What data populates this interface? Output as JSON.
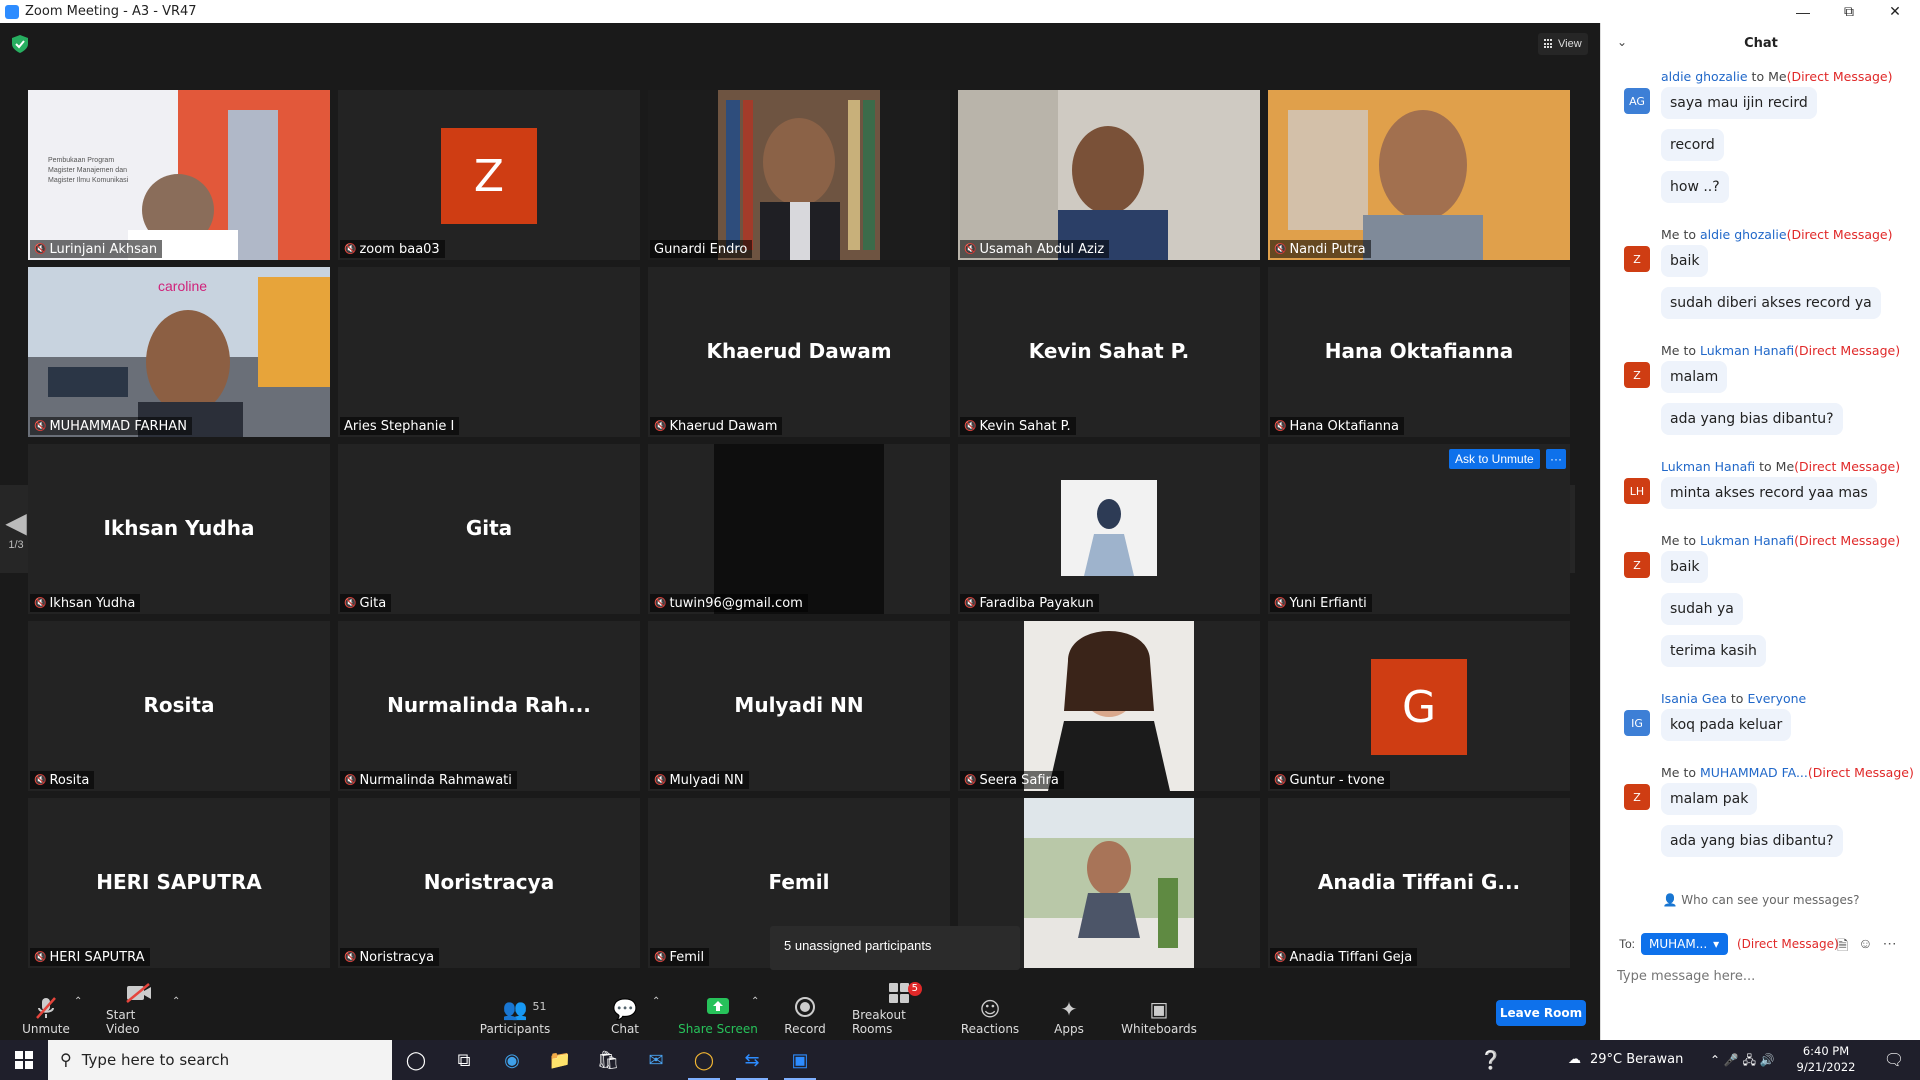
{
  "window": {
    "title": "Zoom Meeting - A3 - VR47"
  },
  "meeting": {
    "view_label": "View",
    "tiles": [
      {
        "name": "Lurinjani Akhsan",
        "big": "",
        "avatar": "",
        "kind": "video-slide"
      },
      {
        "name": "zoom baa03",
        "big": "",
        "avatar": "Z",
        "kind": "avatar"
      },
      {
        "name": "Gunardi Endro",
        "big": "",
        "avatar": "",
        "kind": "video-books"
      },
      {
        "name": "Usamah Abdul Aziz",
        "big": "",
        "avatar": "",
        "kind": "video-room"
      },
      {
        "name": "Nandi Putra",
        "big": "",
        "avatar": "",
        "kind": "video-warm"
      },
      {
        "name": "MUHAMMAD FARHAN",
        "big": "",
        "avatar": "",
        "kind": "video-outdoor"
      },
      {
        "name": "Aries Stephanie I",
        "big": "",
        "avatar": "",
        "kind": "blank"
      },
      {
        "name": "Khaerud Dawam",
        "big": "Khaerud Dawam",
        "avatar": "",
        "kind": "text"
      },
      {
        "name": "Kevin Sahat P.",
        "big": "Kevin Sahat P.",
        "avatar": "",
        "kind": "text"
      },
      {
        "name": "Hana Oktafianna",
        "big": "Hana Oktafianna",
        "avatar": "",
        "kind": "text"
      },
      {
        "name": "Ikhsan Yudha",
        "big": "Ikhsan Yudha",
        "avatar": "",
        "kind": "text"
      },
      {
        "name": "Gita",
        "big": "Gita",
        "avatar": "",
        "kind": "text"
      },
      {
        "name": "tuwin96@gmail.com",
        "big": "",
        "avatar": "",
        "kind": "video-dark"
      },
      {
        "name": "Faradiba Payakun",
        "big": "",
        "avatar": "",
        "kind": "photo-small"
      },
      {
        "name": "Yuni Erfianti",
        "big": "",
        "avatar": "",
        "kind": "blank"
      },
      {
        "name": "Rosita",
        "big": "Rosita",
        "avatar": "",
        "kind": "text"
      },
      {
        "name": "Nurmalinda Rahmawati",
        "big": "Nurmalinda  Rah...",
        "avatar": "",
        "kind": "text"
      },
      {
        "name": "Mulyadi NN",
        "big": "Mulyadi NN",
        "avatar": "",
        "kind": "text"
      },
      {
        "name": "Seera Safira",
        "big": "",
        "avatar": "",
        "kind": "photo-portrait"
      },
      {
        "name": "Guntur - tvone",
        "big": "",
        "avatar": "G",
        "kind": "avatar"
      },
      {
        "name": "HERI SAPUTRA",
        "big": "HERI SAPUTRA",
        "avatar": "",
        "kind": "text"
      },
      {
        "name": "Noristracya",
        "big": "Noristracya",
        "avatar": "",
        "kind": "text"
      },
      {
        "name": "Femil",
        "big": "Femil",
        "avatar": "",
        "kind": "text"
      },
      {
        "name": "",
        "big": "",
        "avatar": "",
        "kind": "photo-garden"
      },
      {
        "name": "Anadia Tiffani Geja",
        "big": "Anadia Tiffani G...",
        "avatar": "",
        "kind": "text"
      }
    ],
    "ask_unmute": "Ask to Unmute",
    "ask_more": "···",
    "pager": {
      "page": "1/3"
    },
    "tooltip": "5 unassigned participants"
  },
  "toolbar": {
    "unmute": "Unmute",
    "start_video": "Start Video",
    "participants": "Participants",
    "participants_count": "51",
    "chat": "Chat",
    "share_screen": "Share Screen",
    "record": "Record",
    "breakout_rooms": "Breakout Rooms",
    "breakout_badge": "5",
    "reactions": "Reactions",
    "apps": "Apps",
    "whiteboards": "Whiteboards",
    "leave_room": "Leave Room"
  },
  "chat": {
    "title": "Chat",
    "groups": [
      {
        "avatar": "AG",
        "color": "#3d7fd6",
        "from": "aldie ghozalie",
        "to": "Me",
        "tag": "(Direct Message)",
        "from_blue": true,
        "to_blue": false,
        "messages": [
          "saya mau ijin recird",
          "record",
          "how ..?"
        ]
      },
      {
        "avatar": "Z",
        "color": "#cf3d13",
        "from": "Me",
        "to": "aldie ghozalie",
        "tag": "(Direct Message)",
        "from_blue": false,
        "to_blue": true,
        "messages": [
          "baik",
          "sudah diberi akses record ya"
        ]
      },
      {
        "avatar": "Z",
        "color": "#cf3d13",
        "from": "Me",
        "to": "Lukman Hanafi",
        "tag": "(Direct Message)",
        "from_blue": false,
        "to_blue": true,
        "messages": [
          "malam",
          "ada yang bias dibantu?"
        ]
      },
      {
        "avatar": "LH",
        "color": "#cf3d13",
        "from": "Lukman Hanafi",
        "to": "Me",
        "tag": "(Direct Message)",
        "from_blue": true,
        "to_blue": false,
        "messages": [
          "minta akses record yaa mas"
        ]
      },
      {
        "avatar": "Z",
        "color": "#cf3d13",
        "from": "Me",
        "to": "Lukman Hanafi",
        "tag": "(Direct Message)",
        "from_blue": false,
        "to_blue": true,
        "messages": [
          "baik",
          "sudah ya",
          "terima kasih"
        ]
      },
      {
        "avatar": "IG",
        "color": "#3d7fd6",
        "from": "Isania Gea",
        "to": "Everyone",
        "tag": "",
        "from_blue": true,
        "to_blue": true,
        "messages": [
          "koq pada keluar"
        ]
      },
      {
        "avatar": "Z",
        "color": "#cf3d13",
        "from": "Me",
        "to": "MUHAMMAD FA...",
        "tag": "(Direct Message)",
        "from_blue": false,
        "to_blue": true,
        "messages": [
          "malam pak",
          "ada yang bias dibantu?"
        ]
      }
    ],
    "who_can_see": "Who can see your messages?",
    "to_label": "To:",
    "to_value": "MUHAM...",
    "to_tag": "(Direct Message)",
    "input_placeholder": "Type message here..."
  },
  "taskbar": {
    "search_placeholder": "Type here to search",
    "weather": "29°C  Berawan",
    "time": "6:40 PM",
    "date": "9/21/2022"
  }
}
